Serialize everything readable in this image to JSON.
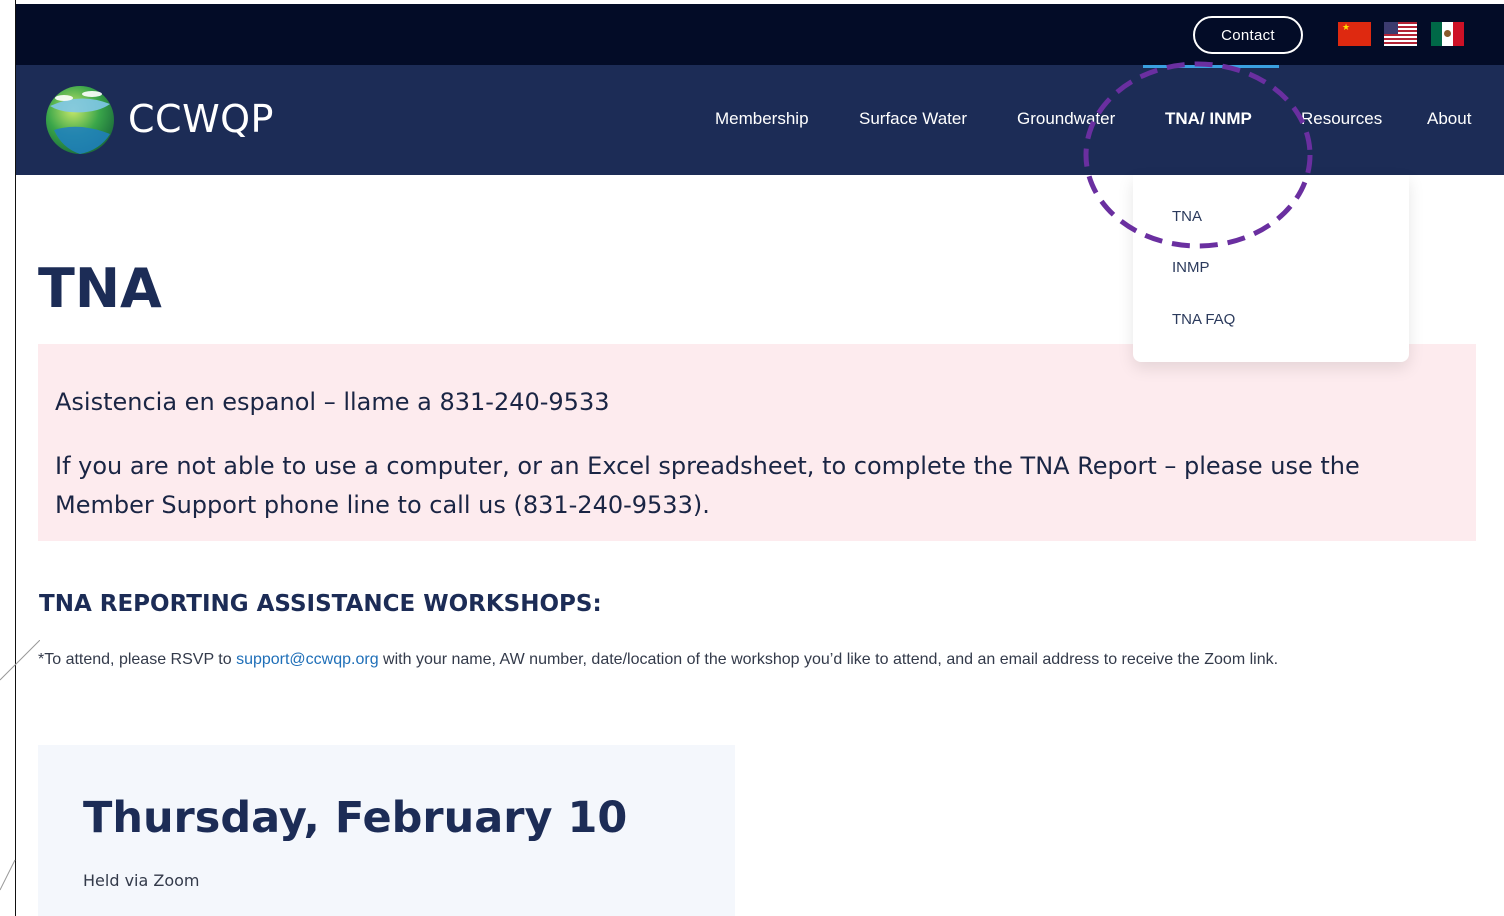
{
  "header": {
    "contact_label": "Contact",
    "flags": [
      "china-flag-icon",
      "usa-flag-icon",
      "mexico-flag-icon"
    ],
    "colors": {
      "topbar": "#030c27",
      "navbar": "#1c2c56",
      "accent": "#3aa0e0"
    }
  },
  "nav": {
    "logo_text": "CCWQP",
    "items": [
      {
        "label": "Membership"
      },
      {
        "label": "Surface Water"
      },
      {
        "label": "Groundwater"
      },
      {
        "label": "TNA/ INMP"
      },
      {
        "label": "Resources"
      },
      {
        "label": "About"
      }
    ],
    "active": "TNA/ INMP",
    "dropdown": [
      "TNA",
      "INMP",
      "TNA FAQ"
    ]
  },
  "main": {
    "title": "TNA",
    "notice": {
      "line1": "Asistencia en espanol – llame a 831-240-9533",
      "line2": "If you are not able to use a computer, or an Excel spreadsheet, to complete the TNA Report – please use the Member Support phone line to call us (831-240-9533).",
      "background": "#fdebee"
    },
    "workshops_heading": "TNA REPORTING ASSISTANCE WORKSHOPS:",
    "rsvp": {
      "before": "*To attend, please RSVP to ",
      "email": "support@ccwqp.org",
      "after": " with your name, AW number, date/location of the workshop you’d like to attend, and an email address to receive the Zoom link."
    },
    "event": {
      "date": "Thursday, February 10",
      "location": "Held via Zoom"
    }
  }
}
